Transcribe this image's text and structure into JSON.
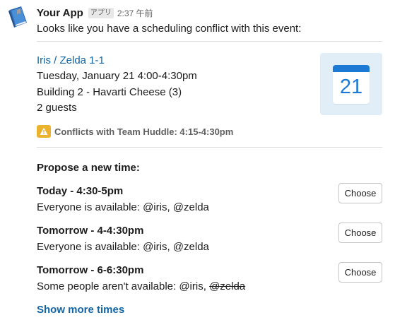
{
  "message": {
    "app_name": "Your App",
    "badge": "アプリ",
    "time": "2:37 午前",
    "intro": "Looks like you have a scheduling conflict with this event:"
  },
  "event": {
    "title": "Iris / Zelda 1-1",
    "datetime": "Tuesday, January 21 4:00-4:30pm",
    "location": "Building 2 - Havarti Cheese (3)",
    "guests": "2 guests",
    "calendar_day": "21",
    "conflict": "Conflicts with Team Huddle: 4:15-4:30pm"
  },
  "propose": {
    "title": "Propose a new time:",
    "options": [
      {
        "time": "Today - 4:30-5pm",
        "availability": "Everyone is available: @iris, @zelda",
        "button": "Choose"
      },
      {
        "time": "Tomorrow - 4-4:30pm",
        "availability": "Everyone is available: @iris, @zelda",
        "button": "Choose"
      },
      {
        "time": "Tomorrow - 6-6:30pm",
        "availability_prefix": "Some people aren't available: @iris, ",
        "unavailable": "@zelda",
        "button": "Choose"
      }
    ],
    "show_more": "Show more times"
  },
  "colors": {
    "link": "#1264a3",
    "calendar_blue": "#1d7ad4",
    "calendar_bg": "#e1edf7",
    "warning": "#ecb22e"
  },
  "icons": {
    "avatar": "blue-book-icon",
    "calendar": "calendar-icon",
    "warning": "warning-icon"
  }
}
